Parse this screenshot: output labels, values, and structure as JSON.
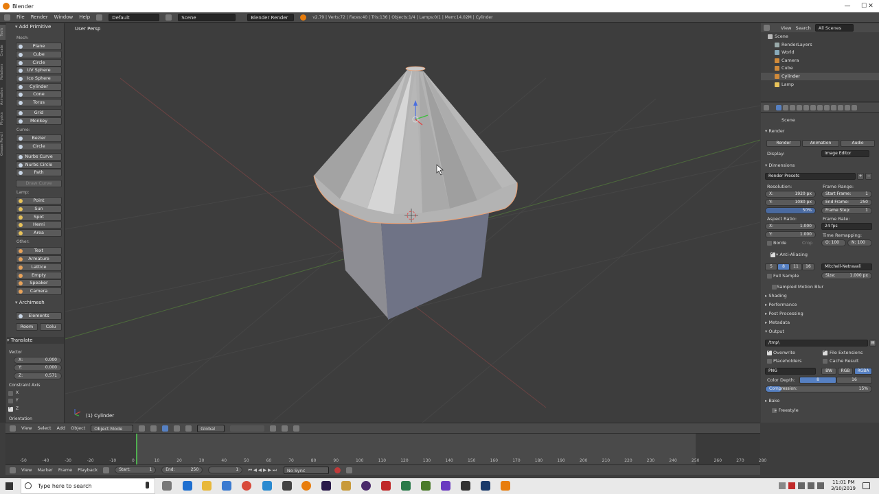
{
  "window": {
    "title": "Blender",
    "min": "—",
    "max": "☐",
    "close": "✕"
  },
  "infobar": {
    "menus": [
      "File",
      "Render",
      "Window",
      "Help"
    ],
    "layout": "Default",
    "scene": "Scene",
    "engine": "Blender Render",
    "stats": "v2.79 | Verts:72 | Faces:40 | Tris:136 | Objects:1/4 | Lamps:0/1 | Mem:14.02M | Cylinder"
  },
  "lefttabs": [
    "Tools",
    "Create",
    "Relations",
    "Animation",
    "Physics",
    "Grease Pencil"
  ],
  "toolshelf": {
    "header": "Add Primitive",
    "mesh_label": "Mesh:",
    "mesh": [
      "Plane",
      "Cube",
      "Circle",
      "UV Sphere",
      "Ico Sphere",
      "Cylinder",
      "Cone",
      "Torus",
      "Grid",
      "Monkey"
    ],
    "curve_label": "Curve:",
    "curve": [
      "Bezier",
      "Circle",
      "Nurbs Curve",
      "Nurbs Circle",
      "Path",
      "Draw Curve"
    ],
    "lamp_label": "Lamp:",
    "lamp": [
      "Point",
      "Sun",
      "Spot",
      "Hemi",
      "Area"
    ],
    "other_label": "Other:",
    "other": [
      "Text",
      "Armature",
      "Lattice",
      "Empty",
      "Speaker",
      "Camera"
    ],
    "archimesh": "Archimesh",
    "elements": "Elements",
    "room": "Room",
    "colu": "Colu",
    "translate": "Translate",
    "vector_label": "Vector",
    "vx": "X:",
    "vxv": "0.000",
    "vy": "Y:",
    "vyv": "0.000",
    "vz": "Z:",
    "vzv": "0.571",
    "constraint": "Constraint Axis",
    "cx": "X",
    "cy": "Y",
    "cz": "Z",
    "orientation": "Orientation"
  },
  "viewport": {
    "persp": "User Persp",
    "object": "(1) Cylinder"
  },
  "vpheader": {
    "view": "View",
    "select": "Select",
    "add": "Add",
    "object": "Object",
    "mode": "Object Mode",
    "orient": "Global"
  },
  "timeline": {
    "ticks": [
      "-50",
      "-40",
      "-30",
      "-20",
      "-10",
      "0",
      "10",
      "20",
      "30",
      "40",
      "50",
      "60",
      "70",
      "80",
      "90",
      "100",
      "110",
      "120",
      "130",
      "140",
      "150",
      "160",
      "170",
      "180",
      "190",
      "200",
      "210",
      "220",
      "230",
      "240",
      "250",
      "260",
      "270",
      "280"
    ],
    "current_frame": 0,
    "range_start": 0,
    "range_end": 250,
    "view": "View",
    "marker": "Marker",
    "frame": "Frame",
    "playback": "Playback",
    "start": "Start:",
    "start_v": "1",
    "end": "End:",
    "end_v": "250",
    "cur_v": "1",
    "sync": "No Sync"
  },
  "outliner": {
    "view": "View",
    "search": "Search",
    "scope": "All Scenes",
    "rows": [
      "Scene",
      "RenderLayers",
      "World",
      "Camera",
      "Cube",
      "Cylinder",
      "Lamp"
    ]
  },
  "props": {
    "scene": "Scene",
    "render": "Render",
    "b_render": "Render",
    "b_anim": "Animation",
    "b_audio": "Audio",
    "display": "Display:",
    "display_v": "Image Editor",
    "dimensions": "Dimensions",
    "presets": "Render Presets",
    "resolution": "Resolution:",
    "rx": "X:",
    "rxv": "1920 px",
    "ry": "Y:",
    "ryv": "1080 px",
    "rpct": "50%",
    "frame_range": "Frame Range:",
    "fs": "Start Frame:",
    "fsv": "1",
    "fe": "End Frame:",
    "fev": "250",
    "fst": "Frame Step:",
    "fstv": "1",
    "aspect": "Aspect Ratio:",
    "ax": "X:",
    "axv": "1.000",
    "ay": "Y:",
    "ayv": "1.000",
    "frame_rate": "Frame Rate:",
    "fps": "24 fps",
    "time_remap": "Time Remapping:",
    "old": "O: 100",
    "new": "N: 100",
    "border": "Borde",
    "crop": "Crop",
    "aa": "Anti-Aliasing",
    "aa5": "5",
    "aa8": "8",
    "aa11": "11",
    "aa16": "16",
    "filter": "Mitchell-Netravali",
    "full_sample": "Full Sample",
    "size": "Size:",
    "size_v": "1.000 px",
    "smb": "Sampled Motion Blur",
    "shading": "Shading",
    "performance": "Performance",
    "post": "Post Processing",
    "metadata": "Metadata",
    "output": "Output",
    "path": "/tmp\\",
    "overwrite": "Overwrite",
    "file_ext": "File Extensions",
    "placeholders": "Placeholders",
    "cache": "Cache Result",
    "format": "PNG",
    "bw": "BW",
    "rgb": "RGB",
    "rgba": "RGBA",
    "depth": "Color Depth:",
    "d8": "8",
    "d16": "16",
    "compression": "Compression:",
    "comp_v": "15%",
    "compression_fraction": 0.15,
    "bake": "Bake",
    "freestyle": "Freestyle"
  },
  "taskbar": {
    "search": "Type here to search",
    "time": "11:01 PM",
    "date": "3/10/2019"
  }
}
